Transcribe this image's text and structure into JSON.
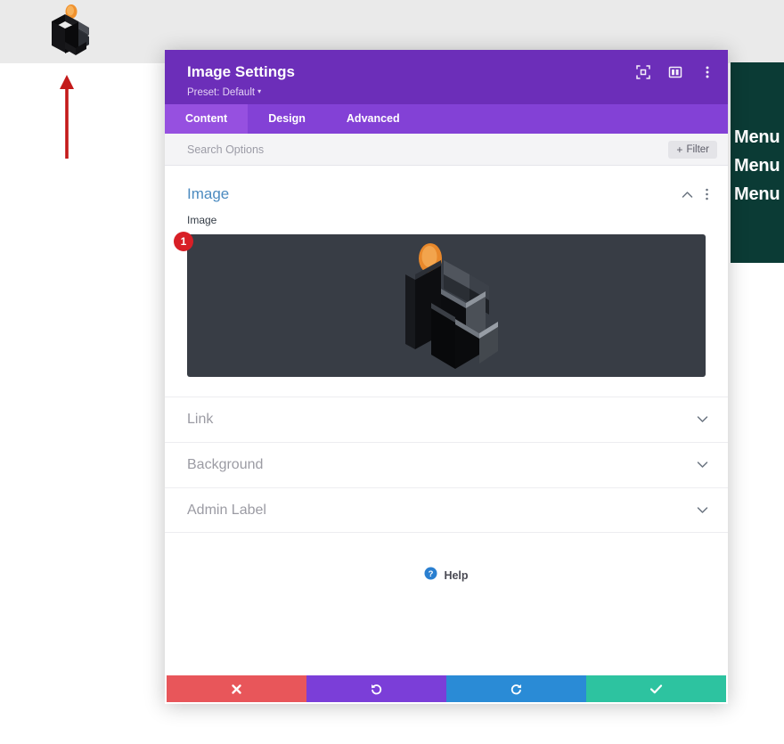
{
  "background": {
    "logo_icon": "isometric-stairs-logo",
    "arrow_icon": "red-up-arrow",
    "menu_panel": {
      "items": [
        "Menu item",
        "Menu item",
        "Menu item"
      ]
    }
  },
  "modal": {
    "title": "Image Settings",
    "preset_label": "Preset: Default",
    "preset_caret": "▾",
    "header_icons": [
      {
        "name": "focus-icon"
      },
      {
        "name": "layout-columns-icon"
      },
      {
        "name": "more-vertical-icon"
      }
    ],
    "tabs": [
      {
        "label": "Content",
        "active": true
      },
      {
        "label": "Design",
        "active": false
      },
      {
        "label": "Advanced",
        "active": false
      }
    ],
    "search": {
      "value": "",
      "placeholder": "Search Options"
    },
    "filter": {
      "plus": "+",
      "label": "Filter"
    },
    "section": {
      "title": "Image",
      "collapse_icon": "chevron-up-icon",
      "menu_icon": "more-vertical-icon"
    },
    "image_field": {
      "label": "Image",
      "badge": "1",
      "preview_icon": "isometric-stairs-image"
    },
    "toggles": [
      {
        "label": "Link",
        "icon": "chevron-down-icon"
      },
      {
        "label": "Background",
        "icon": "chevron-down-icon"
      },
      {
        "label": "Admin Label",
        "icon": "chevron-down-icon"
      }
    ],
    "help": {
      "icon": "question-circle-icon",
      "label": "Help"
    },
    "footer_buttons": [
      {
        "name": "close-button",
        "icon": "x-icon",
        "color": "#e8565a"
      },
      {
        "name": "undo-button",
        "icon": "undo-icon",
        "color": "#7b3ed8"
      },
      {
        "name": "redo-button",
        "icon": "redo-icon",
        "color": "#2a8bd6"
      },
      {
        "name": "save-button",
        "icon": "check-icon",
        "color": "#2dc3a0"
      }
    ]
  },
  "colors": {
    "header_purple": "#6C2EB9",
    "tabbar_purple": "#8341D6",
    "tab_active_purple": "#9650E0",
    "section_title_blue": "#4C8BC0",
    "badge_red": "#d81f26",
    "menu_panel_teal": "#0b3b35",
    "preview_dark": "#383d45"
  }
}
